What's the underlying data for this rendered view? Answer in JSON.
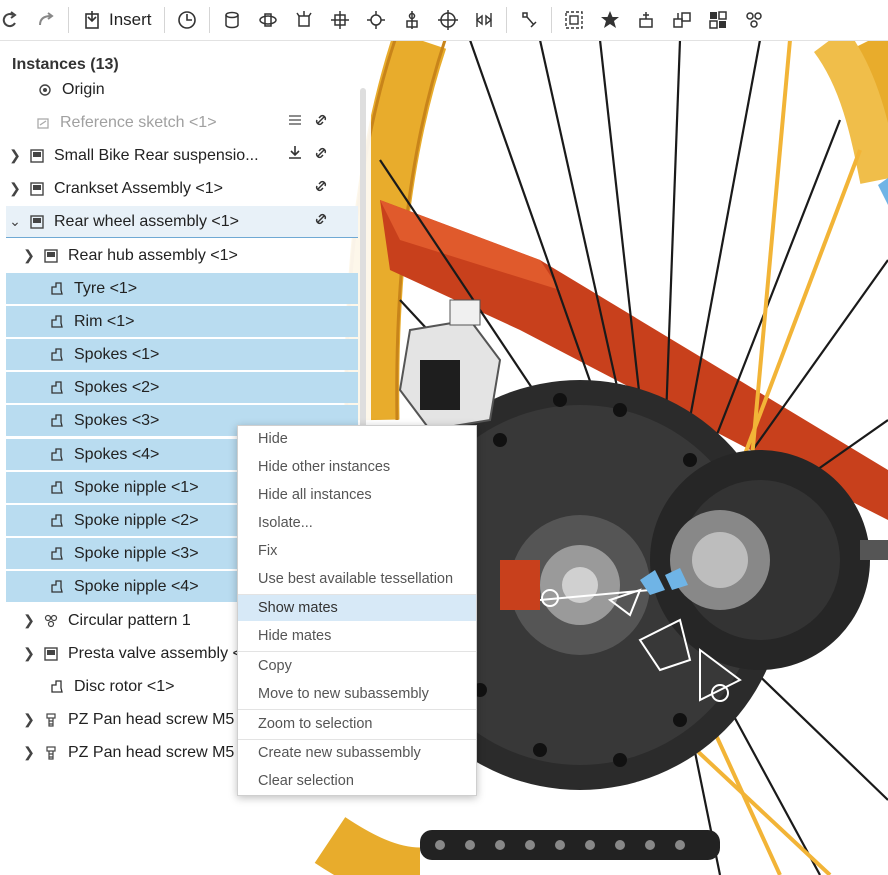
{
  "toolbar": {
    "insert_label": "Insert",
    "icons": [
      "undo-icon",
      "redo-icon",
      "insert-icon",
      "history-icon",
      "cylinder-icon",
      "revolute-icon",
      "slider-icon",
      "planar-icon",
      "ball-icon",
      "cylindrical-icon",
      "fastened-icon",
      "parallel-icon",
      "mate-connector-icon",
      "group-icon",
      "explode-icon",
      "measure-icon",
      "replicate-icon",
      "pattern-icon",
      "feature-icon"
    ]
  },
  "panel": {
    "title": "Instances (13)",
    "rows": [
      {
        "label": "Origin"
      },
      {
        "label": "Reference sketch <1>"
      },
      {
        "label": "Small Bike Rear suspensio..."
      },
      {
        "label": "Crankset Assembly <1>"
      },
      {
        "label": "Rear wheel assembly <1>"
      },
      {
        "label": "Rear hub assembly <1>"
      },
      {
        "label": "Tyre <1>"
      },
      {
        "label": "Rim <1>"
      },
      {
        "label": "Spokes <1>"
      },
      {
        "label": "Spokes <2>"
      },
      {
        "label": "Spokes <3>"
      },
      {
        "label": "Spokes <4>"
      },
      {
        "label": "Spoke nipple <1>"
      },
      {
        "label": "Spoke nipple <2>"
      },
      {
        "label": "Spoke nipple <3>"
      },
      {
        "label": "Spoke nipple <4>"
      },
      {
        "label": "Circular pattern 1"
      },
      {
        "label": "Presta valve assembly <1>"
      },
      {
        "label": "Disc rotor <1>"
      },
      {
        "label": "PZ Pan head screw M5"
      },
      {
        "label": "PZ Pan head screw M5"
      }
    ]
  },
  "context_menu": {
    "items": [
      {
        "label": "Hide"
      },
      {
        "label": "Hide other instances"
      },
      {
        "label": "Hide all instances"
      },
      {
        "label": "Isolate..."
      },
      {
        "label": "Fix"
      },
      {
        "label": "Use best available tessellation"
      },
      {
        "label": "Show mates"
      },
      {
        "label": "Hide mates"
      },
      {
        "label": "Copy"
      },
      {
        "label": "Move to new subassembly"
      },
      {
        "label": "Zoom to selection"
      },
      {
        "label": "Create new subassembly"
      },
      {
        "label": "Clear selection"
      }
    ],
    "highlighted": "Show mates"
  },
  "colors": {
    "selection": "#b9dcf0",
    "menu_highlight": "#d7e9f7",
    "tyre": "#e8ac2c",
    "frame": "#c8401c",
    "rotor": "#2b2b2b"
  }
}
